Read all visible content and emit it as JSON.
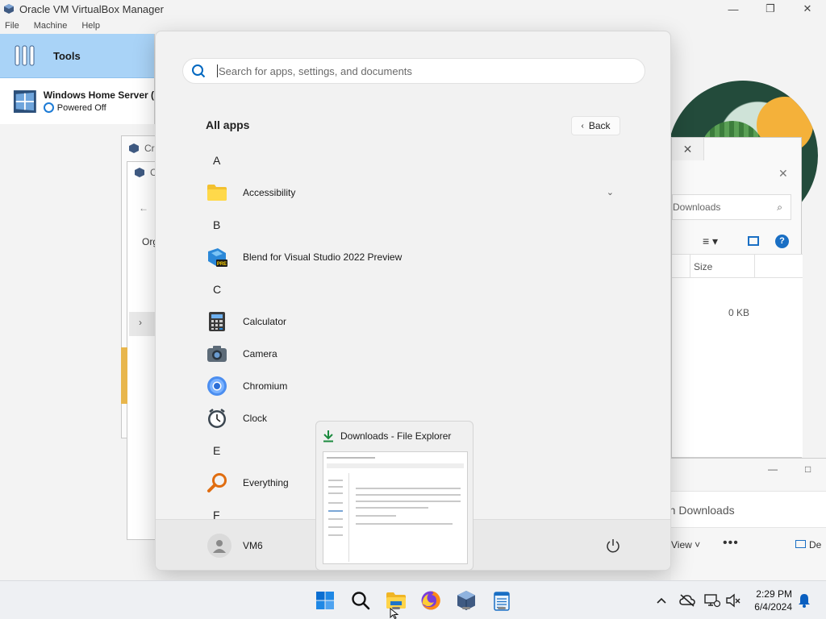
{
  "vbox": {
    "title": "Oracle VM VirtualBox Manager",
    "menu": [
      "File",
      "Machine",
      "Help"
    ],
    "tools_label": "Tools",
    "vm": {
      "name": "Windows Home Server (",
      "state": "Powered Off"
    }
  },
  "background": {
    "dialog_a_title": "Cr",
    "dialog_b_title": "C",
    "dialog_b_org": "Org",
    "explorer": {
      "search_placeholder": "Downloads",
      "col_size": "Size",
      "row_size": "0 KB",
      "search2_placeholder": "rch Downloads",
      "view_label": "View",
      "more_label": "De"
    }
  },
  "start": {
    "search_placeholder": "Search for apps, settings, and documents",
    "all_apps_title": "All apps",
    "back_label": "Back",
    "sections": [
      {
        "letter": "A",
        "apps": [
          {
            "label": "Accessibility",
            "icon": "folder-icon",
            "expandable": true
          }
        ]
      },
      {
        "letter": "B",
        "apps": [
          {
            "label": "Blend for Visual Studio 2022 Preview",
            "icon": "blend-icon"
          }
        ]
      },
      {
        "letter": "C",
        "apps": [
          {
            "label": "Calculator",
            "icon": "calculator-icon"
          },
          {
            "label": "Camera",
            "icon": "camera-icon"
          },
          {
            "label": "Chromium",
            "icon": "chromium-icon"
          },
          {
            "label": "Clock",
            "icon": "clock-icon"
          }
        ]
      },
      {
        "letter": "E",
        "apps": [
          {
            "label": "Everything",
            "icon": "everything-icon"
          }
        ]
      },
      {
        "letter": "F",
        "apps": []
      }
    ],
    "user": "VM6"
  },
  "thumbnail": {
    "title": "Downloads - File Explorer"
  },
  "taskbar": {
    "icons": [
      "windows-start-icon",
      "search-icon",
      "file-explorer-icon",
      "firefox-icon",
      "virtualbox-icon",
      "notepad-icon"
    ],
    "time": "2:29 PM",
    "date": "6/4/2024"
  },
  "colors": {
    "accent": "#0067c0",
    "selection": "#a9d3f7"
  }
}
